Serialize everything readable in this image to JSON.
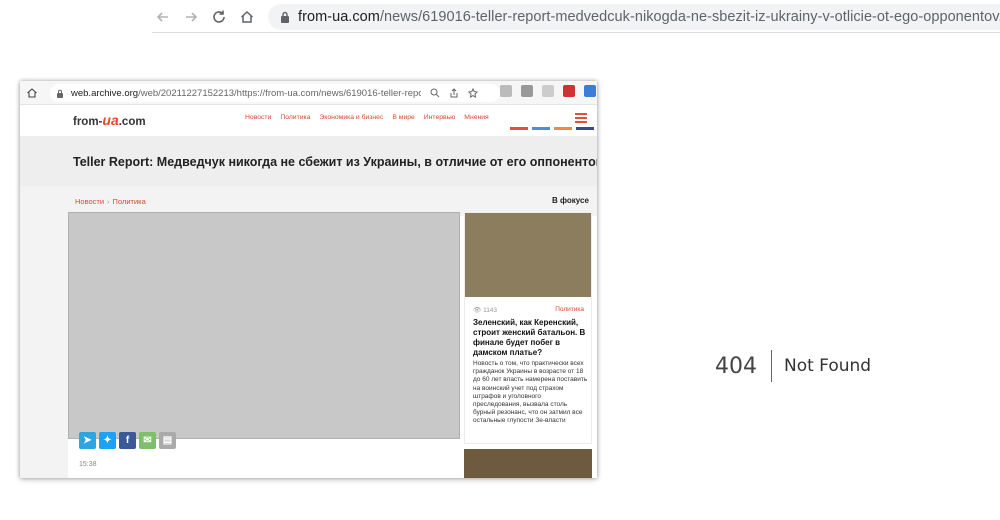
{
  "browser": {
    "url_domain": "from-ua.com",
    "url_path": "/news/619016-teller-report-medvedcuk-nikogda-ne-sbezit-iz-ukrainy-v-otlicie-ot-ego-opponentov.html"
  },
  "embedded": {
    "url_domain": "web.archive.org",
    "url_path": "/web/20211227152213/https://from-ua.com/news/619016-teller-report...",
    "logo_prefix": "from-",
    "logo_mid": "ua",
    "logo_suffix": ".com",
    "nav": [
      "Новости",
      "Политика",
      "Экономика и бизнес",
      "В мире",
      "Интервью",
      "Мнения"
    ],
    "headline": "Teller Report: Медведчук никогда не сбежит из Украины, в отличие от его оппонентов",
    "breadcrumb": [
      "Новости",
      "Политика"
    ],
    "breadcrumb_sep": "›",
    "focus_label": "В фокусе",
    "photo_placeholder": "",
    "time": "15:38",
    "sidebar_card": {
      "views": "1143",
      "category": "Политика",
      "headline": "Зеленский, как Керенский, строит женский батальон. В финале будет побег в дамском платье?",
      "description": "Новость о том, что практически всех гражданок Украины в возрасте от 18 до 60 лет власть намерена поставить на воинский учет под страхом штрафов и уголовного преследования, вызвала столь бурный резонанс, что он затмил все остальные глупости Зе-власти",
      "thumb_placeholder": ""
    },
    "card2_placeholder": ""
  },
  "not_found": {
    "code": "404",
    "message": "Not Found"
  },
  "colors": {
    "accent": "#d8482d",
    "telegram": "#2ca5e0",
    "twitter": "#1da1f2",
    "facebook": "#3b5998",
    "email": "#7fbf6a",
    "print": "#aaaaaa"
  }
}
